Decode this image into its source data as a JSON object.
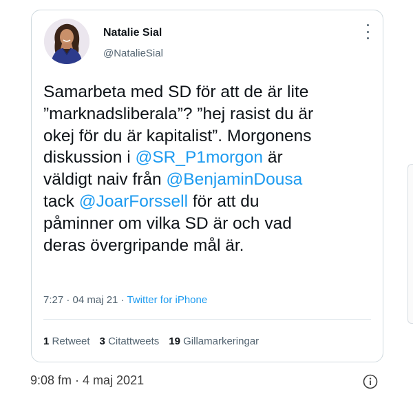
{
  "tweet": {
    "author_name": "Natalie Sial",
    "author_handle": "@NatalieSial",
    "text_parts": [
      "Samarbeta med SD för att de är lite\n”marknadsliberala”? ”hej rasist du är\nokej för du är kapitalist”. Morgonens\ndiskussion i ",
      "@SR_P1morgon",
      " är\nväldigt naiv från ",
      "@BenjaminDousa",
      "\ntack ",
      "@JoarForssell",
      " för att du\npåminner om vilka SD är och vad\nderas övergripande mål är."
    ],
    "time": "7:27 · 04 maj 21 · ",
    "source": "Twitter for iPhone",
    "stats": {
      "retweets_count": "1",
      "retweets_label": "Retweet",
      "quotes_count": "3",
      "quotes_label": "Citattweets",
      "likes_count": "19",
      "likes_label": "Gillamarkeringar"
    }
  },
  "footer": {
    "timestamp": "9:08 fm · 4 maj 2021"
  },
  "icons": {
    "more": "more-vertical-icon",
    "info": "info-icon"
  }
}
